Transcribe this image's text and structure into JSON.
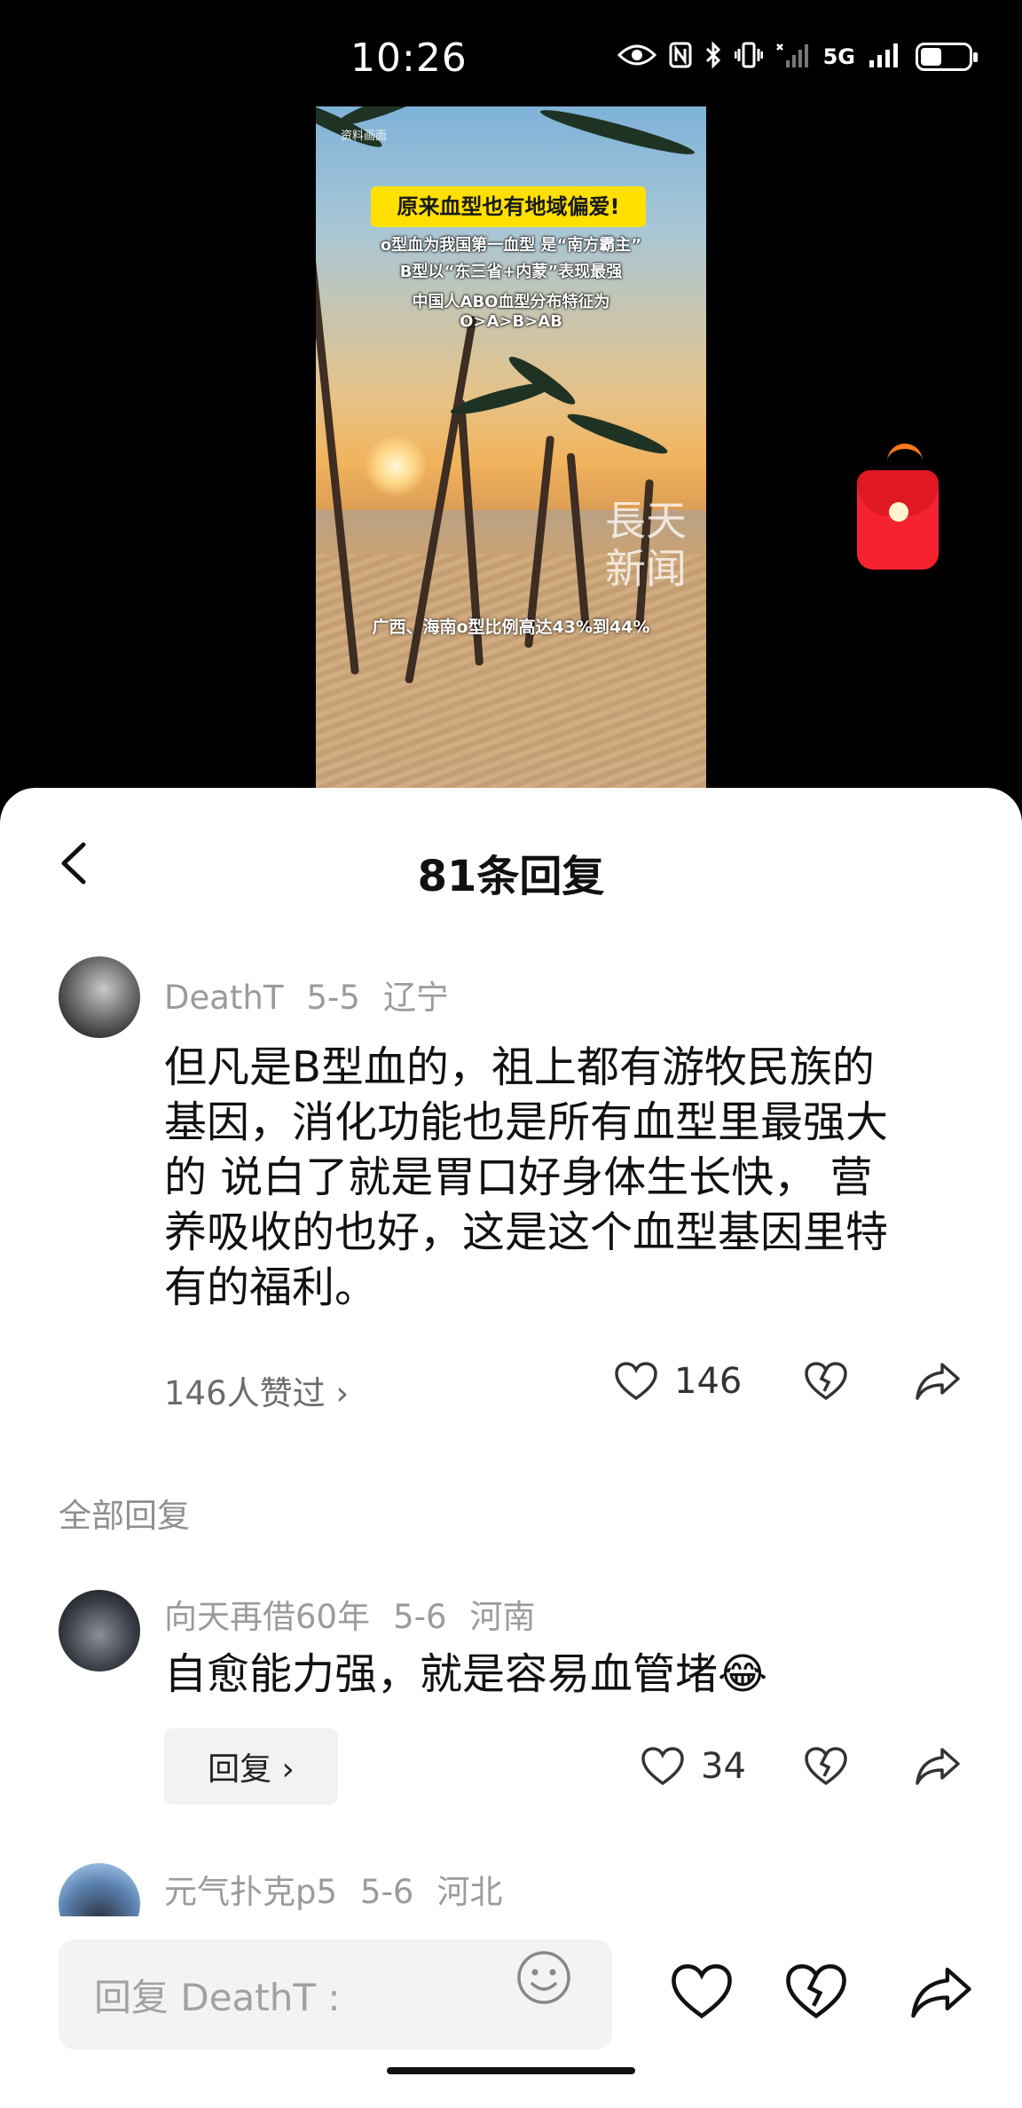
{
  "status_bar": {
    "time": "10:26",
    "network": "5G"
  },
  "video": {
    "small_caption": "资料画面",
    "headline": "原来血型也有地域偏爱!",
    "line1": "o型血为我国第一血型 是“南方霸主”",
    "line2": "B型以“东三省+内蒙”表现最强",
    "line3": "中国人ABO血型分布特征为",
    "line4": "O>A>B>AB",
    "watermark_top": "長天",
    "watermark_bottom": "新闻",
    "bottom_caption": "广西、海南o型比例高达43%到44%"
  },
  "sheet": {
    "title": "81条回复",
    "main_comment": {
      "user": "DeathT",
      "date": "5-5",
      "location": "辽宁",
      "lines": [
        "但凡是B型血的，祖上都有游牧民族的",
        "基因，消化功能也是所有血型里最强大",
        "的 说白了就是胃口好身体生长快， 营",
        "养吸收的也好，这是这个血型基因里特",
        "有的福利。"
      ],
      "likes_link": "146人赞过 ›",
      "like_count": "146"
    },
    "section_label": "全部回复",
    "replies": [
      {
        "user": "向天再借60年",
        "date": "5-6",
        "location": "河南",
        "text": "自愈能力强，就是容易血管堵😂",
        "reply_label": "回复 ›",
        "like_count": "34"
      },
      {
        "user": "元气扑克p5",
        "date": "5-6",
        "location": "河北"
      }
    ]
  },
  "bottom_bar": {
    "input_placeholder": "回复 DeathT :"
  },
  "colors": {
    "heart_stroke": "#333333",
    "red_envelope": "#f5232f",
    "headline_bg": "#ffe000"
  }
}
